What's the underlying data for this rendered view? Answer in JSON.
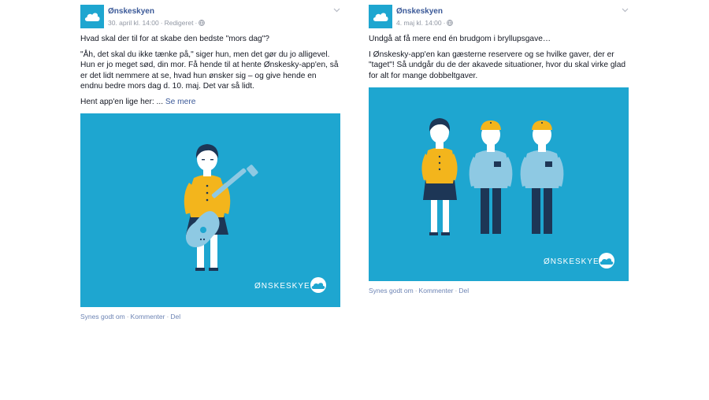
{
  "posts": [
    {
      "page_name": "Ønskeskyen",
      "date": "30. april kl. 14:00",
      "edited": "Redigeret",
      "paragraphs": [
        "Hvad skal der til for at skabe den bedste \"mors dag\"?",
        "\"Åh, det skal du ikke tænke på,\" siger hun, men det gør du jo alligevel. Hun er jo meget sød, din mor. Få hende til at hente Ønskesky-app'en, så er det lidt nemmere at se, hvad hun ønsker sig – og give hende en endnu bedre mors dag d. 10. maj. Det var så lidt."
      ],
      "last_line": "Hent app'en lige her: ...",
      "see_more": "Se mere",
      "image_logo": "ØNSKESKYEN",
      "actions": [
        "Synes godt om",
        "Kommenter",
        "Del"
      ]
    },
    {
      "page_name": "Ønskeskyen",
      "date": "4. maj kl. 14:00",
      "paragraphs": [
        "Undgå at få mere end én brudgom i bryllupsgave…",
        "I Ønskesky-app'en kan gæsterne reservere og se hvilke gaver, der er \"taget\"! Så undgår du de der akavede situationer, hvor du skal virke glad for alt for mange dobbeltgaver."
      ],
      "image_logo": "ØNSKESKYEN",
      "actions": [
        "Synes godt om",
        "Kommenter",
        "Del"
      ]
    }
  ],
  "colors": {
    "brand_blue": "#1ea6d0",
    "link_blue": "#3b5998",
    "shirt_yellow": "#f3b51c",
    "shirt_light_blue": "#8ec9e3",
    "pants_navy": "#1d3656"
  },
  "icons": [
    "cloud-icon",
    "globe-icon",
    "chevron-down-icon"
  ]
}
